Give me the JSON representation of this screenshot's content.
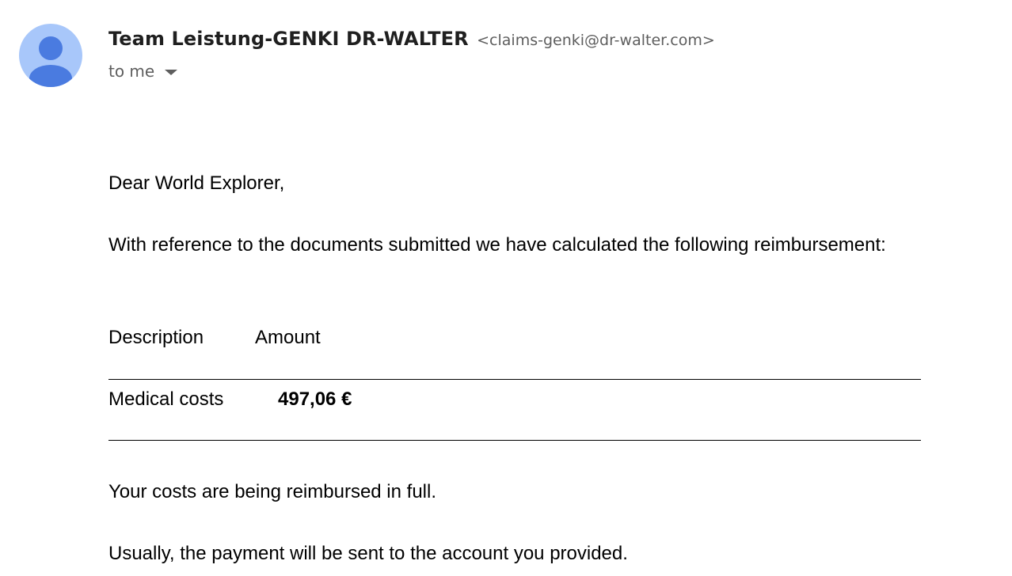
{
  "message": {
    "sender_name": "Team Leistung-GENKI DR-WALTER",
    "sender_email": "<claims-genki@dr-walter.com>",
    "recipient_label": "to me",
    "greeting": "Dear World Explorer,",
    "intro": "With reference to the documents submitted we have calculated the following reimbursement:",
    "table": {
      "headers": [
        "Description",
        "Amount"
      ],
      "rows": [
        {
          "description": "Medical costs",
          "amount": "497,06 €"
        }
      ]
    },
    "reimbursed_note": "Your costs are being reimbursed in full.",
    "payment_note": "Usually, the payment will be sent to the account you provided."
  },
  "icons": {
    "avatar": "default-person-avatar-icon",
    "recipient_details": "caret-down-icon"
  },
  "colors": {
    "avatar_bg": "#a8c7fa",
    "avatar_fg": "#4a7be0",
    "sender_name": "#1f1f1f",
    "secondary_text": "#5e5e5e"
  }
}
